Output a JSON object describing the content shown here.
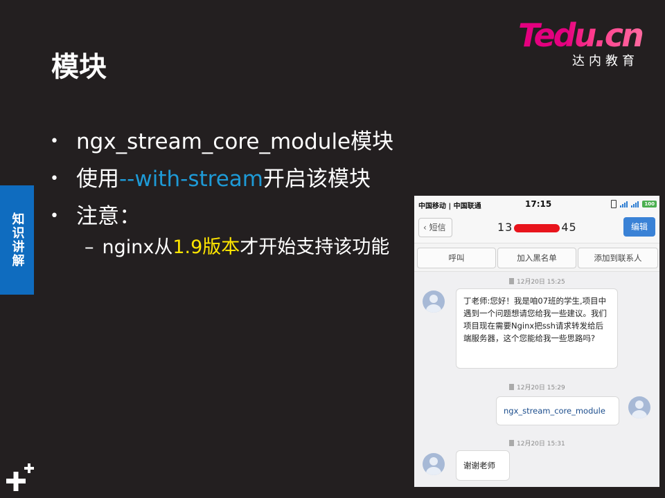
{
  "slide": {
    "title": "模块",
    "side_tab": "知识讲解",
    "logo_main": "Tedu.cn",
    "logo_sub": "达内教育",
    "bullets": [
      {
        "text": "ngx_stream_core_module模块"
      },
      {
        "pre": "使用",
        "highlight": "--with-stream",
        "post": "开启该模块"
      },
      {
        "text": "注意："
      }
    ],
    "sub_bullet": {
      "dash": "–",
      "pre": "nginx从",
      "highlight": "1.9版本",
      "post": "才开始支持该功能"
    },
    "colors": {
      "background": "#231f20",
      "highlight_blue": "#1e9ad6",
      "highlight_yellow": "#ffe600",
      "side_tab": "#0f6cbf"
    }
  },
  "phone": {
    "status": {
      "carrier": "中国移动 | 中国联通",
      "time": "17:15",
      "battery": "100"
    },
    "nav": {
      "back": "短信",
      "number_prefix": "13",
      "number_suffix": "45",
      "edit": "编辑"
    },
    "actions": [
      "呼叫",
      "加入黑名单",
      "添加到联系人"
    ],
    "messages": [
      {
        "time": "12月20日 15:25",
        "side": "left",
        "text": "丁老师:您好！我是咱07班的学生,项目中遇到一个问题想请您给我一些建议。我们项目现在需要Nginx把ssh请求转发给后端服务器，这个您能给我一些思路吗?"
      },
      {
        "time": "12月20日 15:29",
        "side": "right",
        "text": "ngx_stream_core_module"
      },
      {
        "time": "12月20日 15:31",
        "side": "left",
        "text": "谢谢老师"
      }
    ]
  }
}
